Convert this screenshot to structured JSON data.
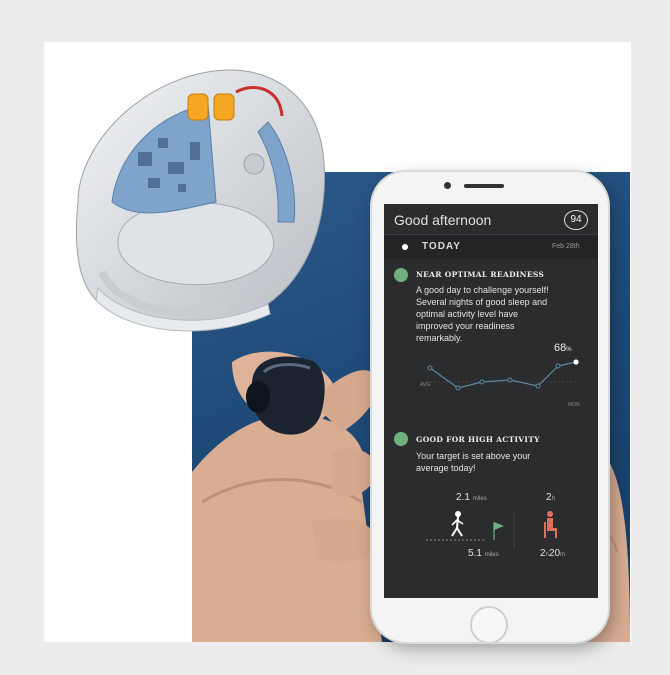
{
  "screen": {
    "greeting": "Good afternoon",
    "score": "94",
    "today_label": "TODAY",
    "date": "Feb 28th",
    "readiness": {
      "title": "NEAR OPTIMAL READINESS",
      "text_lines": [
        "A good day to challenge yourself!",
        "Several nights of good sleep and",
        "optimal activity level have",
        "improved your readiness",
        "remarkably."
      ]
    },
    "chart_value": "68",
    "chart_value_unit": "%",
    "chart_first_label": "AVG",
    "chart_last_label": "MON",
    "activity": {
      "title": "GOOD FOR HIGH ACTIVITY",
      "text_lines": [
        "Your target is set above your",
        "average today!"
      ],
      "walk_value": "2.1",
      "walk_unit": "miles",
      "target_value": "5.1",
      "target_unit": "miles",
      "sit_value": "2",
      "sit_unit": "h",
      "time_value": "2",
      "time_h": "h",
      "time_min": "20",
      "time_unit": "m"
    }
  },
  "colors": {
    "accent_green": "#6fb07d",
    "chart_line": "#5a8aa0",
    "screen_bg": "#2b2c2e",
    "background_blue": "#1f4b7a"
  },
  "icons": [
    "readiness-icon",
    "activity-flag-icon",
    "walking-person-icon",
    "sitting-person-icon",
    "home-button-icon"
  ]
}
